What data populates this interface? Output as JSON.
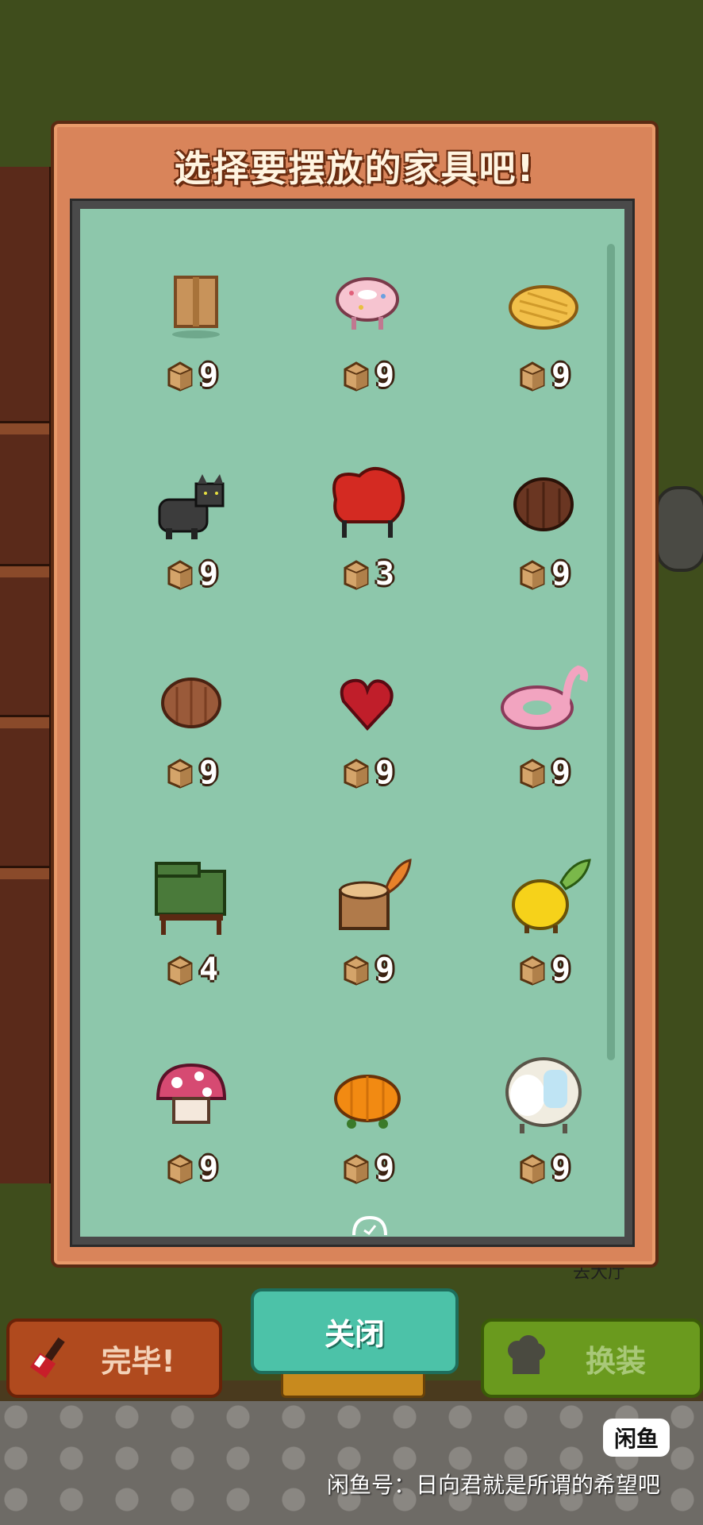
{
  "panel": {
    "title": "选择要摆放的家具吧!"
  },
  "items": [
    {
      "icon": "cardboard-box-icon",
      "count": "9"
    },
    {
      "icon": "donut-stool-icon",
      "count": "9"
    },
    {
      "icon": "melon-bread-cushion-icon",
      "count": "9"
    },
    {
      "icon": "black-cat-chair-icon",
      "count": "9"
    },
    {
      "icon": "red-armchair-icon",
      "count": "3"
    },
    {
      "icon": "chocolate-stool-icon",
      "count": "9"
    },
    {
      "icon": "brown-stool-icon",
      "count": "9"
    },
    {
      "icon": "red-heart-stool-icon",
      "count": "9"
    },
    {
      "icon": "flamingo-float-icon",
      "count": "9"
    },
    {
      "icon": "green-armchair-icon",
      "count": "4"
    },
    {
      "icon": "tree-stump-stool-icon",
      "count": "9"
    },
    {
      "icon": "lemon-stool-icon",
      "count": "9"
    },
    {
      "icon": "mushroom-stool-icon",
      "count": "9"
    },
    {
      "icon": "orange-stool-icon",
      "count": "9"
    },
    {
      "icon": "egg-chair-icon",
      "count": "9"
    }
  ],
  "buttons": {
    "finish": "完毕!",
    "close": "关闭",
    "swap": "换装"
  },
  "background": {
    "go_lobby": "去大厅"
  },
  "watermark": {
    "logo": "闲鱼",
    "text": "闲鱼号：日向君就是所谓的希望吧"
  }
}
